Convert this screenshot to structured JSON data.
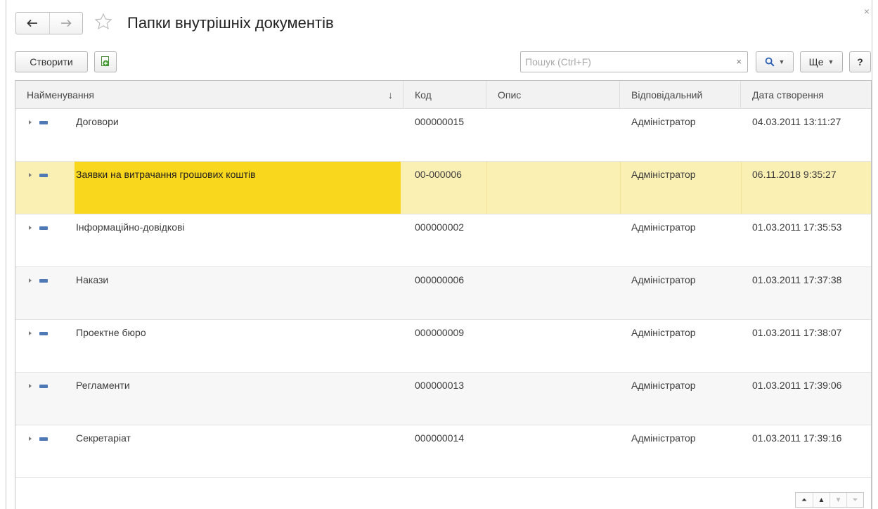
{
  "window": {
    "close_glyph": "×"
  },
  "header": {
    "title": "Папки внутрішніх документів",
    "back_icon": "arrow-left-icon",
    "forward_icon": "arrow-right-icon",
    "favorite_icon": "star-outline-icon"
  },
  "toolbar": {
    "create_label": "Створити",
    "copy_icon": "copy-document-icon",
    "search_placeholder": "Пошук (Ctrl+F)",
    "search_value": "",
    "clear_glyph": "×",
    "find_glyph": "🔍",
    "more_label": "Ще",
    "help_label": "?"
  },
  "table": {
    "columns": [
      "Найменування",
      "Код",
      "Опис",
      "Відповідальний",
      "Дата створення"
    ],
    "sort_glyph": "↓",
    "rows": [
      {
        "name": "Договори",
        "code": "000000015",
        "description": "",
        "responsible": "Адміністратор",
        "created": "04.03.2011 13:11:27"
      },
      {
        "name": "Заявки на витрачання грошових коштів",
        "code": "00-000006",
        "description": "",
        "responsible": "Адміністратор",
        "created": "06.11.2018 9:35:27",
        "selected": true
      },
      {
        "name": "Інформаційно-довідкові",
        "code": "000000002",
        "description": "",
        "responsible": "Адміністратор",
        "created": "01.03.2011 17:35:53"
      },
      {
        "name": "Накази",
        "code": "000000006",
        "description": "",
        "responsible": "Адміністратор",
        "created": "01.03.2011 17:37:38"
      },
      {
        "name": "Проектне бюро",
        "code": "000000009",
        "description": "",
        "responsible": "Адміністратор",
        "created": "01.03.2011 17:38:07"
      },
      {
        "name": "Регламенти",
        "code": "000000013",
        "description": "",
        "responsible": "Адміністратор",
        "created": "01.03.2011 17:39:06"
      },
      {
        "name": "Секретаріат",
        "code": "000000014",
        "description": "",
        "responsible": "Адміністратор",
        "created": "01.03.2011 17:39:16"
      }
    ]
  },
  "pager": {
    "first": "⏶",
    "prev": "▲",
    "next": "▼",
    "last": "⏷"
  },
  "colors": {
    "selected_row": "#fbf0b4",
    "selected_cell": "#f9d71c",
    "folder_icon": "#4f79b5"
  }
}
